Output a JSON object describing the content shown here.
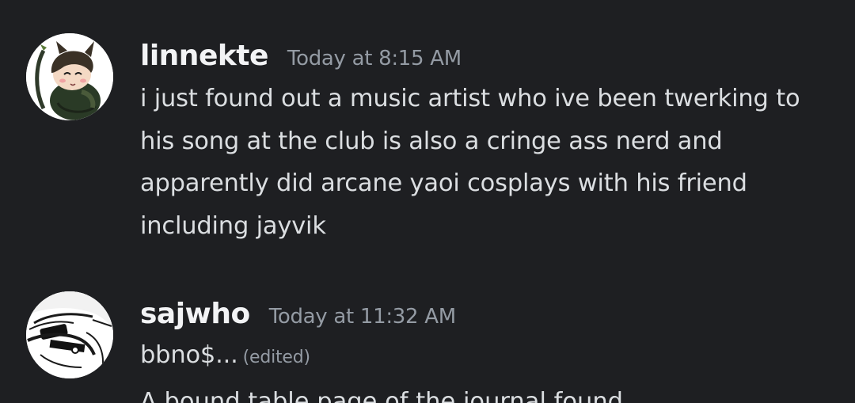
{
  "messages": [
    {
      "username": "linnekte",
      "timestamp": "Today at 8:15 AM",
      "text": "i just found out a music artist who ive been twerking to his song at the club is also a cringe ass nerd and apparently did arcane yaoi cosplays with his friend including jayvik",
      "avatar": "cartoon-cat-character-icon"
    },
    {
      "username": "sajwho",
      "timestamp": "Today at 11:32 AM",
      "text": "bbno$...",
      "edited_label": "(edited)",
      "avatar": "monochrome-drawing-icon"
    }
  ],
  "partial_next_line": "A bound table page of the journal found"
}
